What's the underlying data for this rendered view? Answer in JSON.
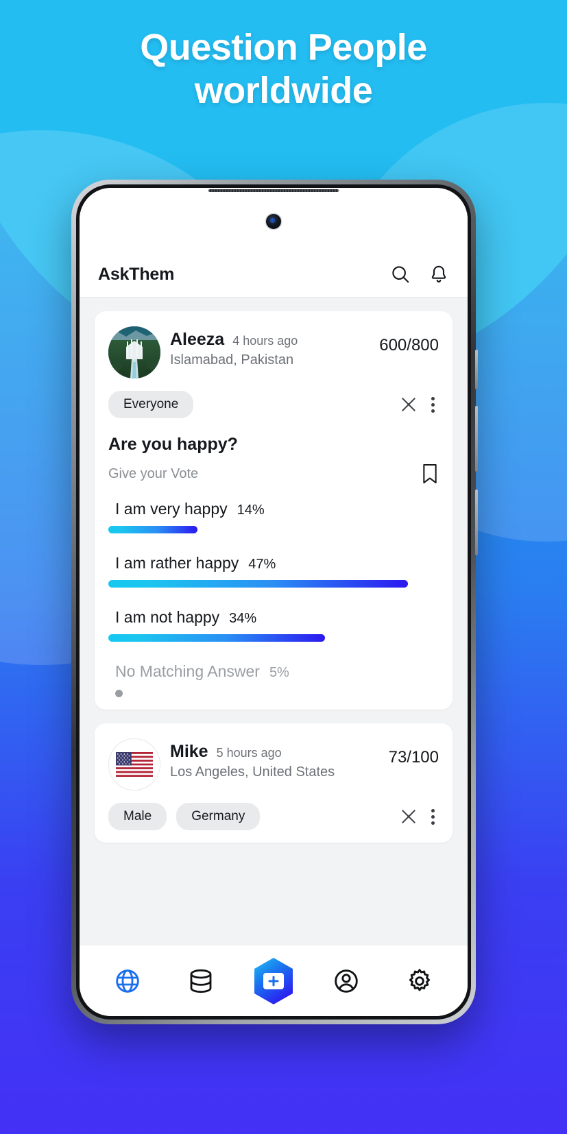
{
  "promo": {
    "headline_line1": "Question People",
    "headline_line2": "worldwide",
    "bg_color": "#1fb6ef",
    "accent_color": "#2b18f0"
  },
  "app": {
    "title": "AskThem",
    "header_icons": [
      {
        "name": "search-icon",
        "label": "Search"
      },
      {
        "name": "bell-icon",
        "label": "Notifications"
      }
    ]
  },
  "feed": {
    "posts": [
      {
        "author": "Aleeza",
        "time": "4 hours ago",
        "location": "Islamabad, Pakistan",
        "vote_count": "600/800",
        "avatar_type": "photo-mosque",
        "tags": [
          "Everyone"
        ],
        "question": "Are you happy?",
        "vote_hint": "Give your Vote",
        "bookmark_icon": "bookmark-icon",
        "close_icon": "close-icon",
        "more_icon": "more-vertical-icon",
        "options": [
          {
            "label": "I am very happy",
            "pct": "14%",
            "value": 14,
            "muted": false
          },
          {
            "label": "I am rather happy",
            "pct": "47%",
            "value": 47,
            "muted": false
          },
          {
            "label": "I am not happy",
            "pct": "34%",
            "value": 34,
            "muted": false
          },
          {
            "label": "No Matching Answer",
            "pct": "5%",
            "value": 5,
            "muted": true
          }
        ]
      },
      {
        "author": "Mike",
        "time": "5 hours ago",
        "location": "Los Angeles, United States",
        "vote_count": "73/100",
        "avatar_type": "flag-us",
        "tags": [
          "Male",
          "Germany"
        ],
        "close_icon": "close-icon",
        "more_icon": "more-vertical-icon"
      }
    ]
  },
  "bottom_nav": {
    "items": [
      {
        "name": "globe-icon",
        "label": "Discover",
        "active": true
      },
      {
        "name": "database-icon",
        "label": "My Polls",
        "active": false
      },
      {
        "name": "add-hexagon-button",
        "label": "Create",
        "active": false
      },
      {
        "name": "profile-icon",
        "label": "Profile",
        "active": false
      },
      {
        "name": "gear-icon",
        "label": "Settings",
        "active": false
      }
    ]
  }
}
